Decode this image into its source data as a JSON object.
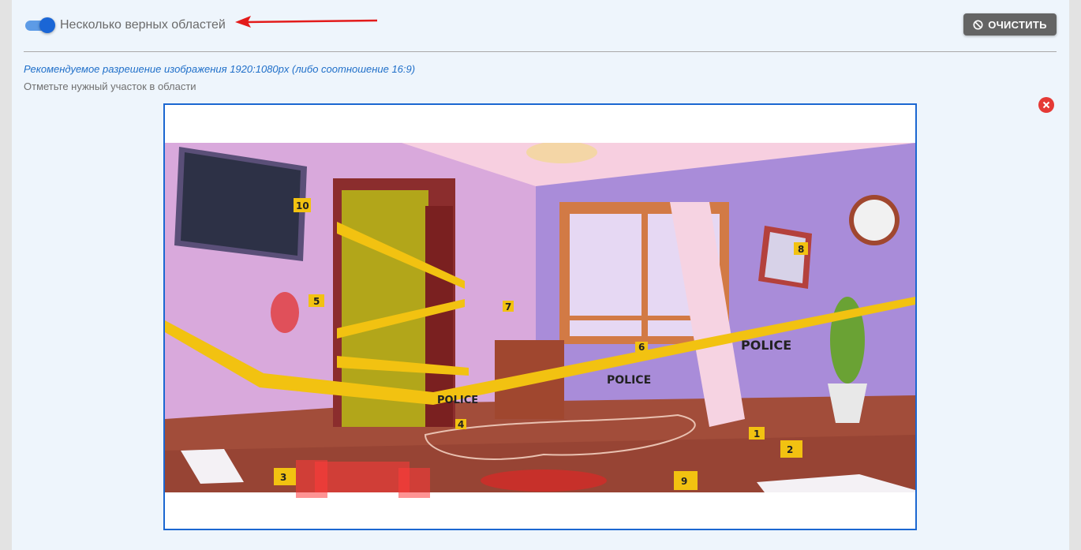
{
  "toggle": {
    "label": "Несколько верных областей",
    "checked": true,
    "color": "#1a66d6"
  },
  "clear_button": {
    "label": "ОЧИСТИТЬ",
    "icon": "ban-icon"
  },
  "hints": {
    "resolution": "Рекомендуемое разрешение изображения 1920:1080px (либо соотношение 16:9)",
    "instruction": "Отметьте нужный участок в области"
  },
  "image": {
    "remove_icon": "close-circle-icon",
    "tape_text": "POLICE",
    "evidence_markers": [
      "1",
      "2",
      "3",
      "4",
      "5",
      "6",
      "7",
      "8",
      "9",
      "10"
    ]
  },
  "colors": {
    "accent": "#1b67d1",
    "arrow": "#e31b1b",
    "selection": "#ff3b3b",
    "button": "#646464"
  }
}
